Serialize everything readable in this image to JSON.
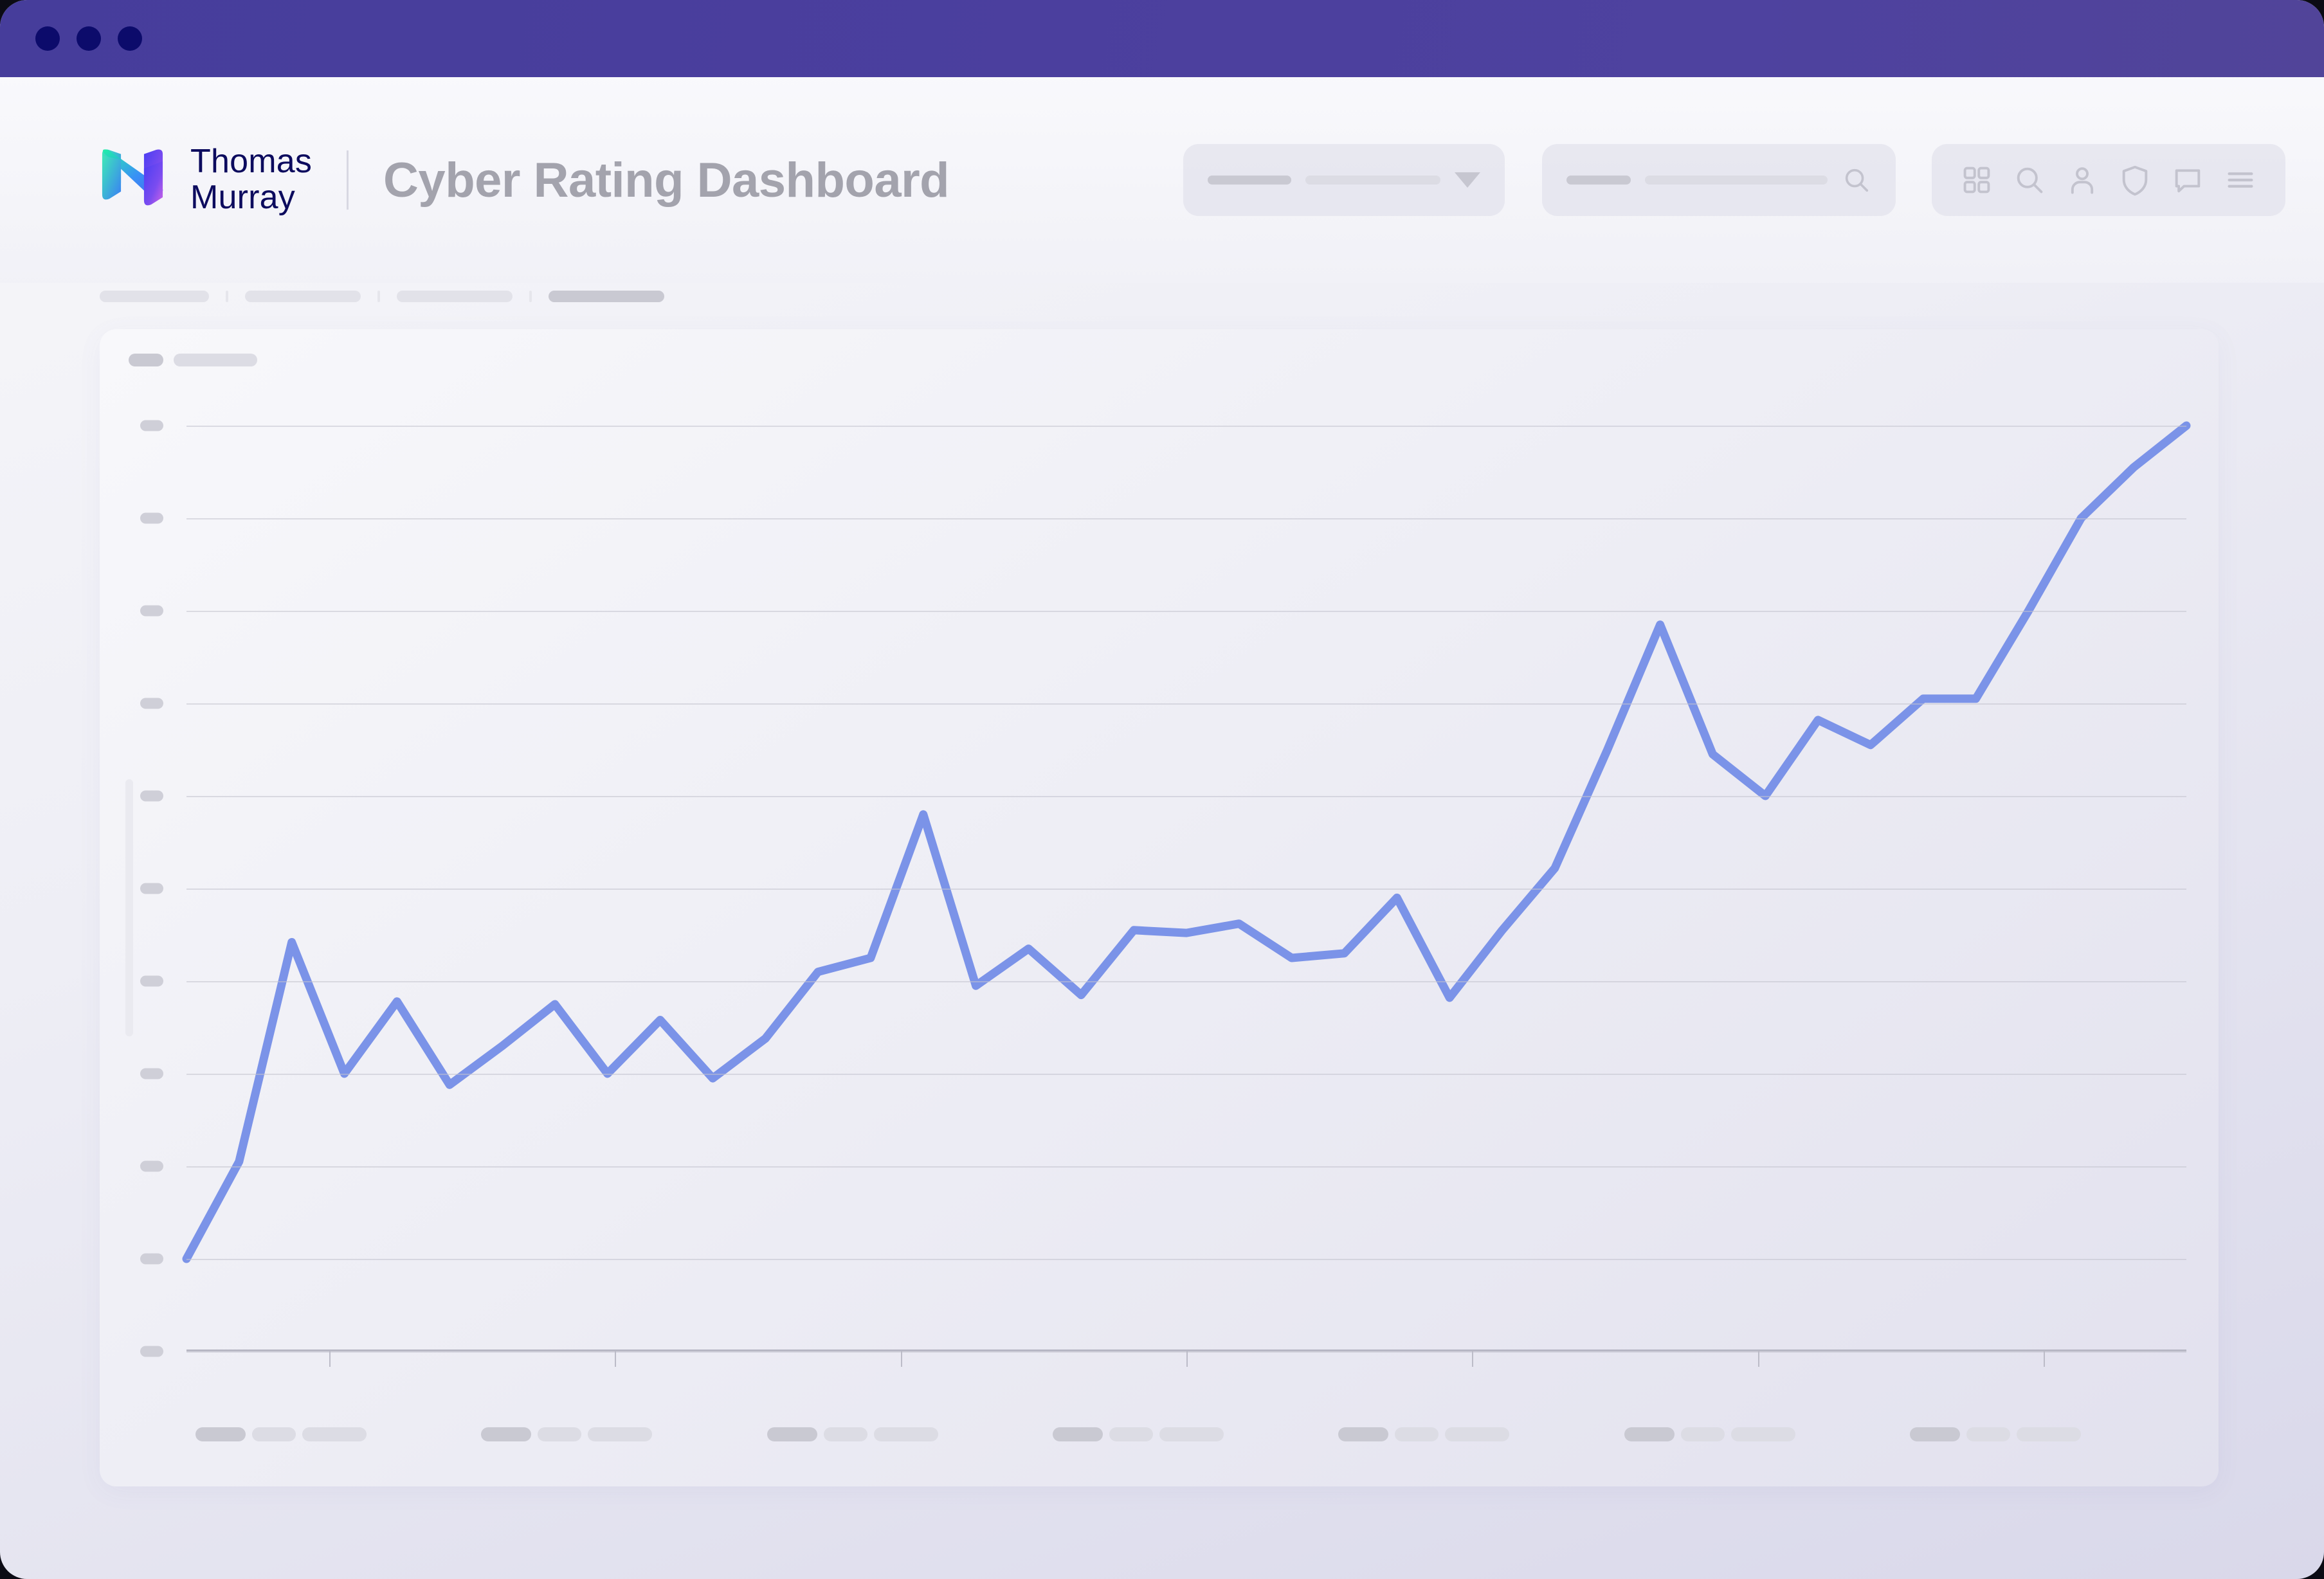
{
  "window": {
    "dots": [
      "close-dot",
      "minimize-dot",
      "maximize-dot"
    ],
    "titlebar_color": "#4b3f9e"
  },
  "header": {
    "brand_name": "Thomas\nMurray",
    "app_title": "Cyber Rating Dashboard",
    "logo_icon": "thomas-murray-logo",
    "logo_gradient": [
      "#1ff0a8",
      "#3b82f6",
      "#5b3df0",
      "#c95fe8"
    ],
    "dropdown": {
      "label_skeleton_width": 130,
      "value_skeleton_width": 210,
      "caret_icon": "chevron-down-icon"
    },
    "search": {
      "label_skeleton_width": 100,
      "value_skeleton_width": 250,
      "icon": "search-icon"
    },
    "icons": [
      {
        "name": "apps-grid-icon"
      },
      {
        "name": "search-icon"
      },
      {
        "name": "user-icon"
      },
      {
        "name": "shield-icon"
      },
      {
        "name": "message-icon"
      },
      {
        "name": "hamburger-menu-icon"
      }
    ]
  },
  "breadcrumbs": [
    {
      "name": "breadcrumb-item-1",
      "width": 170,
      "active": false
    },
    {
      "name": "breadcrumb-item-2",
      "width": 180,
      "active": false
    },
    {
      "name": "breadcrumb-item-3",
      "width": 180,
      "active": false
    },
    {
      "name": "breadcrumb-item-4",
      "width": 180,
      "active": true
    }
  ],
  "card": {
    "title_badge_width": 54,
    "title_text_width": 130
  },
  "chart_data": {
    "type": "line",
    "title": "",
    "subtitle": "",
    "xlabel": "",
    "ylabel": "",
    "grid": true,
    "legend": false,
    "line_color": "#7b93e8",
    "line_width": 13,
    "ylim": [
      0,
      10
    ],
    "yticks": [
      0,
      1,
      2,
      3,
      4,
      5,
      6,
      7,
      8,
      9,
      10
    ],
    "ytick_labels": [
      "",
      "",
      "",
      "",
      "",
      "",
      "",
      "",
      "",
      "",
      ""
    ],
    "xticks": [
      0,
      1,
      2,
      3,
      4,
      5,
      6
    ],
    "xtick_labels": [
      "",
      "",
      "",
      "",
      "",
      "",
      ""
    ],
    "x": [
      0,
      1,
      2,
      3,
      4,
      5,
      6,
      7,
      8,
      9,
      10,
      11,
      12,
      13,
      14,
      15,
      16,
      17,
      18,
      19,
      20,
      21,
      22,
      23,
      24,
      25,
      26,
      27,
      28,
      29,
      30,
      31,
      32,
      33,
      34,
      35,
      36,
      37,
      38
    ],
    "values": [
      1.0,
      2.05,
      4.42,
      3.0,
      3.78,
      2.88,
      3.3,
      3.75,
      3.0,
      3.58,
      2.95,
      3.38,
      4.1,
      4.25,
      5.8,
      3.95,
      4.35,
      3.85,
      4.55,
      4.52,
      4.62,
      4.25,
      4.3,
      4.9,
      3.82,
      4.55,
      5.22,
      6.5,
      7.85,
      6.45,
      6.0,
      6.82,
      6.55,
      7.05,
      7.05,
      8.0,
      9.0,
      9.55,
      10.0
    ]
  }
}
